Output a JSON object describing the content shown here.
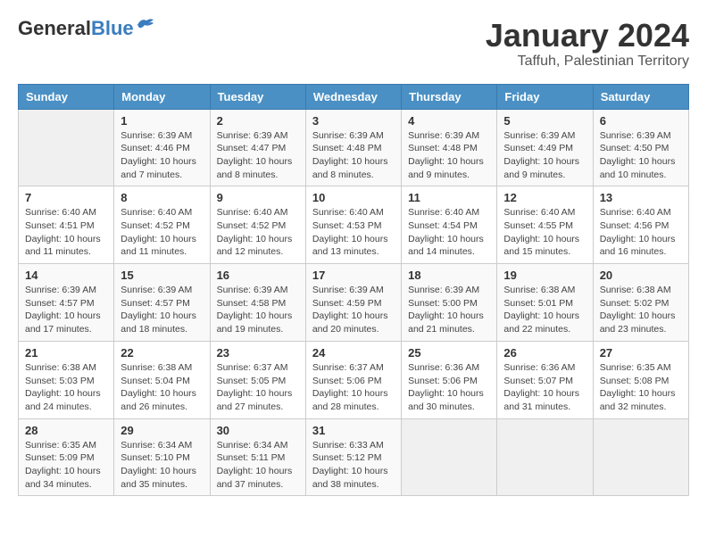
{
  "header": {
    "logo_general": "General",
    "logo_blue": "Blue",
    "month_title": "January 2024",
    "location": "Taffuh, Palestinian Territory"
  },
  "weekdays": [
    "Sunday",
    "Monday",
    "Tuesday",
    "Wednesday",
    "Thursday",
    "Friday",
    "Saturday"
  ],
  "weeks": [
    [
      {
        "day": "",
        "sunrise": "",
        "sunset": "",
        "daylight": ""
      },
      {
        "day": "1",
        "sunrise": "Sunrise: 6:39 AM",
        "sunset": "Sunset: 4:46 PM",
        "daylight": "Daylight: 10 hours and 7 minutes."
      },
      {
        "day": "2",
        "sunrise": "Sunrise: 6:39 AM",
        "sunset": "Sunset: 4:47 PM",
        "daylight": "Daylight: 10 hours and 8 minutes."
      },
      {
        "day": "3",
        "sunrise": "Sunrise: 6:39 AM",
        "sunset": "Sunset: 4:48 PM",
        "daylight": "Daylight: 10 hours and 8 minutes."
      },
      {
        "day": "4",
        "sunrise": "Sunrise: 6:39 AM",
        "sunset": "Sunset: 4:48 PM",
        "daylight": "Daylight: 10 hours and 9 minutes."
      },
      {
        "day": "5",
        "sunrise": "Sunrise: 6:39 AM",
        "sunset": "Sunset: 4:49 PM",
        "daylight": "Daylight: 10 hours and 9 minutes."
      },
      {
        "day": "6",
        "sunrise": "Sunrise: 6:39 AM",
        "sunset": "Sunset: 4:50 PM",
        "daylight": "Daylight: 10 hours and 10 minutes."
      }
    ],
    [
      {
        "day": "7",
        "sunrise": "Sunrise: 6:40 AM",
        "sunset": "Sunset: 4:51 PM",
        "daylight": "Daylight: 10 hours and 11 minutes."
      },
      {
        "day": "8",
        "sunrise": "Sunrise: 6:40 AM",
        "sunset": "Sunset: 4:52 PM",
        "daylight": "Daylight: 10 hours and 11 minutes."
      },
      {
        "day": "9",
        "sunrise": "Sunrise: 6:40 AM",
        "sunset": "Sunset: 4:52 PM",
        "daylight": "Daylight: 10 hours and 12 minutes."
      },
      {
        "day": "10",
        "sunrise": "Sunrise: 6:40 AM",
        "sunset": "Sunset: 4:53 PM",
        "daylight": "Daylight: 10 hours and 13 minutes."
      },
      {
        "day": "11",
        "sunrise": "Sunrise: 6:40 AM",
        "sunset": "Sunset: 4:54 PM",
        "daylight": "Daylight: 10 hours and 14 minutes."
      },
      {
        "day": "12",
        "sunrise": "Sunrise: 6:40 AM",
        "sunset": "Sunset: 4:55 PM",
        "daylight": "Daylight: 10 hours and 15 minutes."
      },
      {
        "day": "13",
        "sunrise": "Sunrise: 6:40 AM",
        "sunset": "Sunset: 4:56 PM",
        "daylight": "Daylight: 10 hours and 16 minutes."
      }
    ],
    [
      {
        "day": "14",
        "sunrise": "Sunrise: 6:39 AM",
        "sunset": "Sunset: 4:57 PM",
        "daylight": "Daylight: 10 hours and 17 minutes."
      },
      {
        "day": "15",
        "sunrise": "Sunrise: 6:39 AM",
        "sunset": "Sunset: 4:57 PM",
        "daylight": "Daylight: 10 hours and 18 minutes."
      },
      {
        "day": "16",
        "sunrise": "Sunrise: 6:39 AM",
        "sunset": "Sunset: 4:58 PM",
        "daylight": "Daylight: 10 hours and 19 minutes."
      },
      {
        "day": "17",
        "sunrise": "Sunrise: 6:39 AM",
        "sunset": "Sunset: 4:59 PM",
        "daylight": "Daylight: 10 hours and 20 minutes."
      },
      {
        "day": "18",
        "sunrise": "Sunrise: 6:39 AM",
        "sunset": "Sunset: 5:00 PM",
        "daylight": "Daylight: 10 hours and 21 minutes."
      },
      {
        "day": "19",
        "sunrise": "Sunrise: 6:38 AM",
        "sunset": "Sunset: 5:01 PM",
        "daylight": "Daylight: 10 hours and 22 minutes."
      },
      {
        "day": "20",
        "sunrise": "Sunrise: 6:38 AM",
        "sunset": "Sunset: 5:02 PM",
        "daylight": "Daylight: 10 hours and 23 minutes."
      }
    ],
    [
      {
        "day": "21",
        "sunrise": "Sunrise: 6:38 AM",
        "sunset": "Sunset: 5:03 PM",
        "daylight": "Daylight: 10 hours and 24 minutes."
      },
      {
        "day": "22",
        "sunrise": "Sunrise: 6:38 AM",
        "sunset": "Sunset: 5:04 PM",
        "daylight": "Daylight: 10 hours and 26 minutes."
      },
      {
        "day": "23",
        "sunrise": "Sunrise: 6:37 AM",
        "sunset": "Sunset: 5:05 PM",
        "daylight": "Daylight: 10 hours and 27 minutes."
      },
      {
        "day": "24",
        "sunrise": "Sunrise: 6:37 AM",
        "sunset": "Sunset: 5:06 PM",
        "daylight": "Daylight: 10 hours and 28 minutes."
      },
      {
        "day": "25",
        "sunrise": "Sunrise: 6:36 AM",
        "sunset": "Sunset: 5:06 PM",
        "daylight": "Daylight: 10 hours and 30 minutes."
      },
      {
        "day": "26",
        "sunrise": "Sunrise: 6:36 AM",
        "sunset": "Sunset: 5:07 PM",
        "daylight": "Daylight: 10 hours and 31 minutes."
      },
      {
        "day": "27",
        "sunrise": "Sunrise: 6:35 AM",
        "sunset": "Sunset: 5:08 PM",
        "daylight": "Daylight: 10 hours and 32 minutes."
      }
    ],
    [
      {
        "day": "28",
        "sunrise": "Sunrise: 6:35 AM",
        "sunset": "Sunset: 5:09 PM",
        "daylight": "Daylight: 10 hours and 34 minutes."
      },
      {
        "day": "29",
        "sunrise": "Sunrise: 6:34 AM",
        "sunset": "Sunset: 5:10 PM",
        "daylight": "Daylight: 10 hours and 35 minutes."
      },
      {
        "day": "30",
        "sunrise": "Sunrise: 6:34 AM",
        "sunset": "Sunset: 5:11 PM",
        "daylight": "Daylight: 10 hours and 37 minutes."
      },
      {
        "day": "31",
        "sunrise": "Sunrise: 6:33 AM",
        "sunset": "Sunset: 5:12 PM",
        "daylight": "Daylight: 10 hours and 38 minutes."
      },
      {
        "day": "",
        "sunrise": "",
        "sunset": "",
        "daylight": ""
      },
      {
        "day": "",
        "sunrise": "",
        "sunset": "",
        "daylight": ""
      },
      {
        "day": "",
        "sunrise": "",
        "sunset": "",
        "daylight": ""
      }
    ]
  ]
}
